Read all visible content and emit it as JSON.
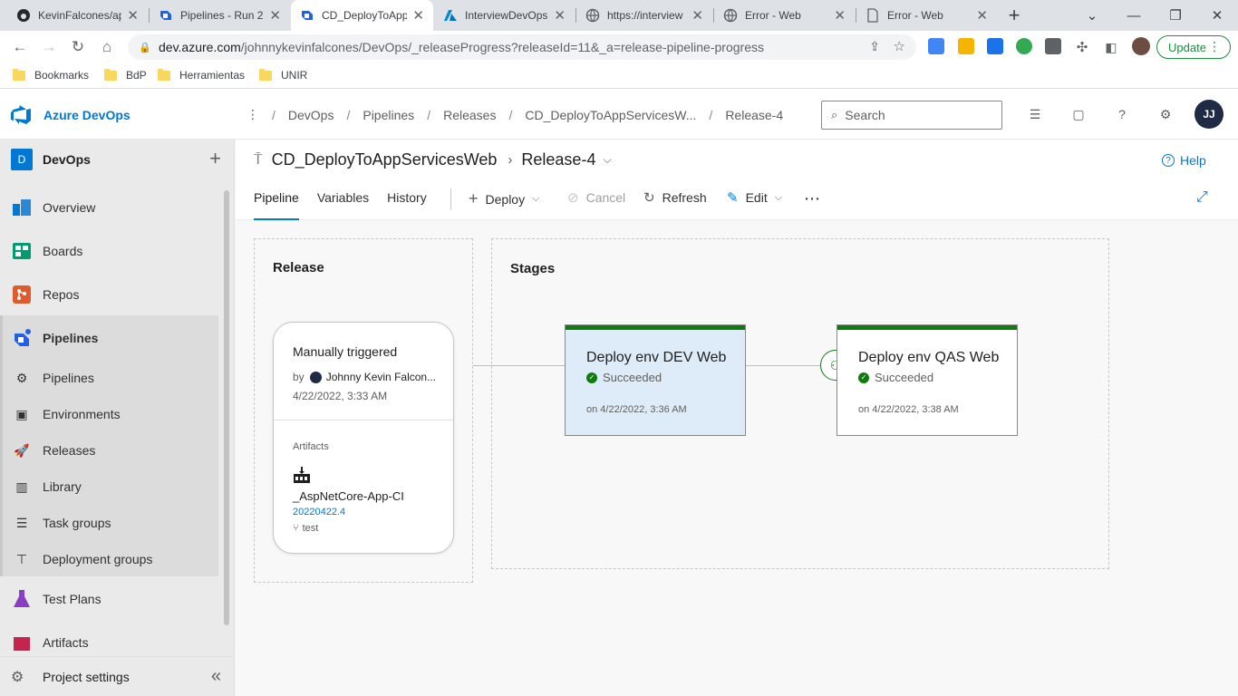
{
  "browser": {
    "tabs": [
      {
        "title": "KevinFalcones/ap",
        "icon": "github-icon"
      },
      {
        "title": "Pipelines - Run 2(",
        "icon": "azure-pipelines-icon"
      },
      {
        "title": "CD_DeployToApp",
        "icon": "azure-pipelines-icon",
        "active": true
      },
      {
        "title": "InterviewDevOps",
        "icon": "azure-icon"
      },
      {
        "title": "https://interview",
        "icon": "globe-icon"
      },
      {
        "title": "Error - Web",
        "icon": "globe-icon"
      },
      {
        "title": "Error - Web",
        "icon": "document-icon"
      }
    ],
    "url_host": "dev.azure.com",
    "url_path": "/johnnykevinfalcones/DevOps/_releaseProgress?releaseId=11&_a=release-pipeline-progress",
    "update_label": "Update",
    "bookmarks": [
      "Bookmarks",
      "BdP",
      "Herramientas",
      "UNIR"
    ]
  },
  "ado": {
    "brand": "Azure DevOps",
    "breadcrumbs": [
      "DevOps",
      "Pipelines",
      "Releases",
      "CD_DeployToAppServicesW...",
      "Release-4"
    ],
    "search_placeholder": "Search",
    "avatar_initials": "JJ"
  },
  "sidebar": {
    "project_initial": "D",
    "project_name": "DevOps",
    "items": [
      {
        "label": "Overview"
      },
      {
        "label": "Boards"
      },
      {
        "label": "Repos"
      },
      {
        "label": "Pipelines"
      },
      {
        "label": "Pipelines"
      },
      {
        "label": "Environments"
      },
      {
        "label": "Releases"
      },
      {
        "label": "Library"
      },
      {
        "label": "Task groups"
      },
      {
        "label": "Deployment groups"
      },
      {
        "label": "Test Plans"
      },
      {
        "label": "Artifacts"
      }
    ],
    "settings_label": "Project settings"
  },
  "page": {
    "pipeline_name": "CD_DeployToAppServicesWeb",
    "release_name": "Release-4",
    "help_label": "Help",
    "tabs": [
      "Pipeline",
      "Variables",
      "History"
    ],
    "commands": {
      "deploy": "Deploy",
      "cancel": "Cancel",
      "refresh": "Refresh",
      "edit": "Edit"
    }
  },
  "release": {
    "section_title": "Release",
    "trigger": "Manually triggered",
    "by_prefix": "by",
    "by_name": "Johnny Kevin Falcon...",
    "date": "4/22/2022, 3:33 AM",
    "artifacts_label": "Artifacts",
    "artifact_name": "_AspNetCore-App-CI",
    "artifact_version": "20220422.4",
    "artifact_branch": "test"
  },
  "stages": {
    "section_title": "Stages",
    "items": [
      {
        "name": "Deploy env DEV Web",
        "status": "Succeeded",
        "date": "on 4/22/2022, 3:36 AM",
        "status_color": "#107c10"
      },
      {
        "name": "Deploy env QAS Web",
        "status": "Succeeded",
        "date": "on 4/22/2022, 3:38 AM",
        "status_color": "#107c10"
      }
    ]
  }
}
